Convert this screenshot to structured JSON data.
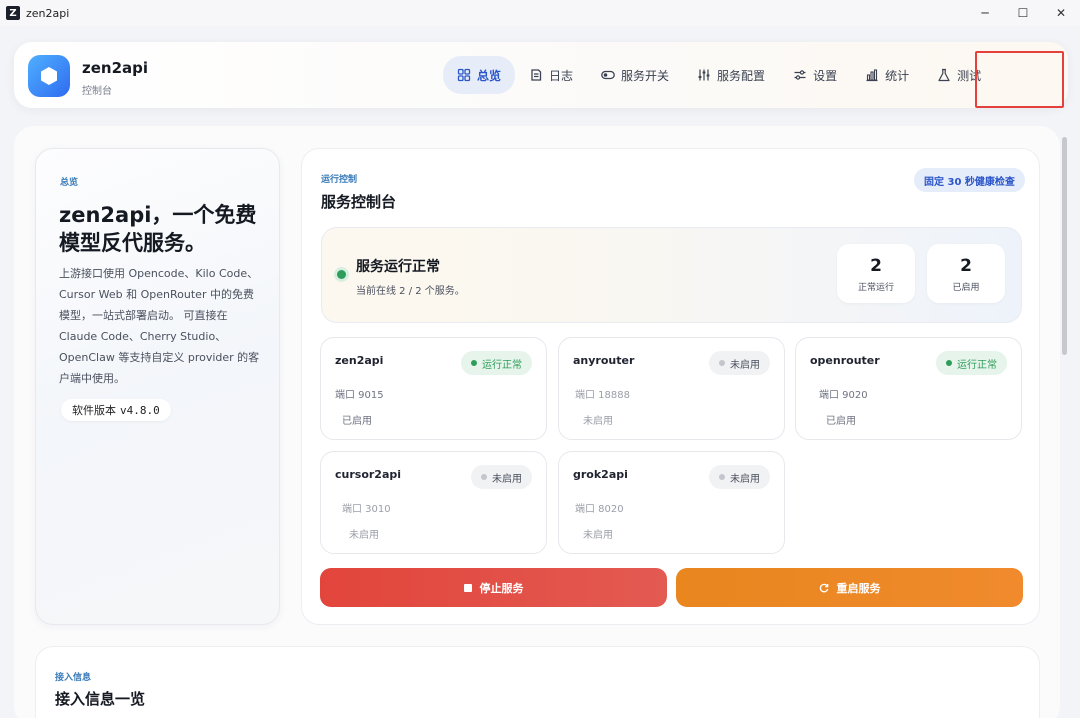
{
  "window": {
    "title": "zen2api",
    "app_icon_letter": "Z",
    "controls": {
      "minimize": "─",
      "maximize": "☐",
      "close": "✕"
    }
  },
  "brand": {
    "name": "zen2api",
    "subtitle": "控制台"
  },
  "nav": {
    "items": [
      {
        "label": "总览",
        "icon": "grid-icon",
        "active": true
      },
      {
        "label": "日志",
        "icon": "log-icon",
        "active": false
      },
      {
        "label": "服务开关",
        "icon": "toggle-icon",
        "active": false
      },
      {
        "label": "服务配置",
        "icon": "sliders-icon",
        "active": false
      },
      {
        "label": "设置",
        "icon": "settings-icon",
        "active": false
      },
      {
        "label": "统计",
        "icon": "bar-chart-icon",
        "active": false
      },
      {
        "label": "测试",
        "icon": "flask-icon",
        "active": false
      }
    ],
    "highlight_color": "#e4413d"
  },
  "overview": {
    "kicker": "总览",
    "title": "zen2api，一个免费模型反代服务。",
    "description": "上游接口使用 Opencode、Kilo Code、Cursor Web 和 OpenRouter 中的免费模型，一站式部署启动。 可直接在 Claude Code、Cherry Studio、OpenClaw 等支持自定义 provider 的客户端中使用。",
    "version_label": "软件版本",
    "version": "v4.8.0"
  },
  "control": {
    "kicker": "运行控制",
    "title": "服务控制台",
    "health_badge": "固定 30 秒健康检查",
    "status": {
      "title": "服务运行正常",
      "subtitle": "当前在线 2 / 2 个服务。",
      "running_count": "2",
      "running_label": "正常运行",
      "enabled_count": "2",
      "enabled_label": "已启用"
    },
    "services": [
      {
        "name": "zen2api",
        "status": "运行正常",
        "port": "端口 9015",
        "state": "已启用",
        "on": true
      },
      {
        "name": "anyrouter",
        "status": "未启用",
        "port": "端口 18888",
        "state": "未启用",
        "on": false
      },
      {
        "name": "openrouter",
        "status": "运行正常",
        "port": "端口 9020",
        "state": "已启用",
        "on": true
      },
      {
        "name": "cursor2api",
        "status": "未启用",
        "port": "端口 3010",
        "state": "未启用",
        "on": false
      },
      {
        "name": "grok2api",
        "status": "未启用",
        "port": "端口 8020",
        "state": "未启用",
        "on": false
      }
    ],
    "stop_button": "停止服务",
    "restart_button": "重启服务"
  },
  "access": {
    "kicker": "接入信息",
    "title": "接入信息一览"
  },
  "colors": {
    "accent": "#2b56c9",
    "ok": "#2e9d5a",
    "stop": "#e2453b",
    "restart": "#e9861e"
  }
}
